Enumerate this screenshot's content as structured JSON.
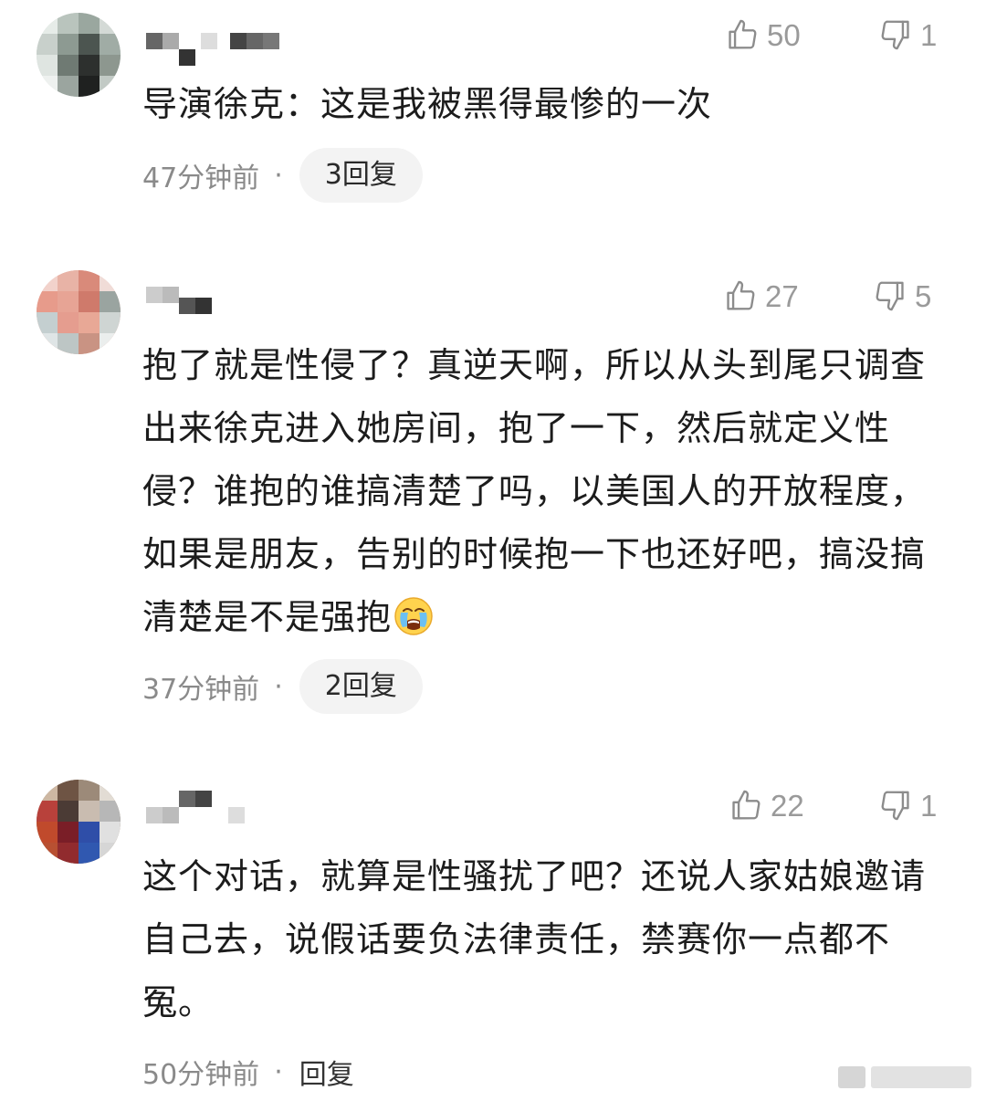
{
  "comments": [
    {
      "username": "",
      "likes": "50",
      "dislikes": "1",
      "text": "导演徐克：这是我被黑得最惨的一次",
      "time": "47分钟前",
      "separator": "·",
      "reply_label": "3回复"
    },
    {
      "username": "",
      "likes": "27",
      "dislikes": "5",
      "text": "抱了就是性侵了？真逆天啊，所以从头到尾只调查出来徐克进入她房间，抱了一下，然后就定义性侵？谁抱的谁搞清楚了吗，以美国人的开放程度，如果是朋友，告别的时候抱一下也还好吧，搞没搞清楚是不是强抱",
      "time": "37分钟前",
      "separator": "·",
      "reply_label": "2回复"
    },
    {
      "username": "",
      "likes": "22",
      "dislikes": "1",
      "text": "这个对话，就算是性骚扰了吧？还说人家姑娘邀请自己去，说假话要负法律责任，禁赛你一点都不冤。",
      "time": "50分钟前",
      "separator": "·",
      "reply_label": "回复"
    }
  ],
  "icons": {
    "like": "thumbs-up-outline",
    "dislike": "thumbs-down-outline",
    "emoji": "crying-face"
  },
  "colors": {
    "text": "#1c1c1c",
    "meta": "#8a8a8a",
    "icon": "#8c8c8c",
    "pill_bg": "#f3f3f3"
  }
}
